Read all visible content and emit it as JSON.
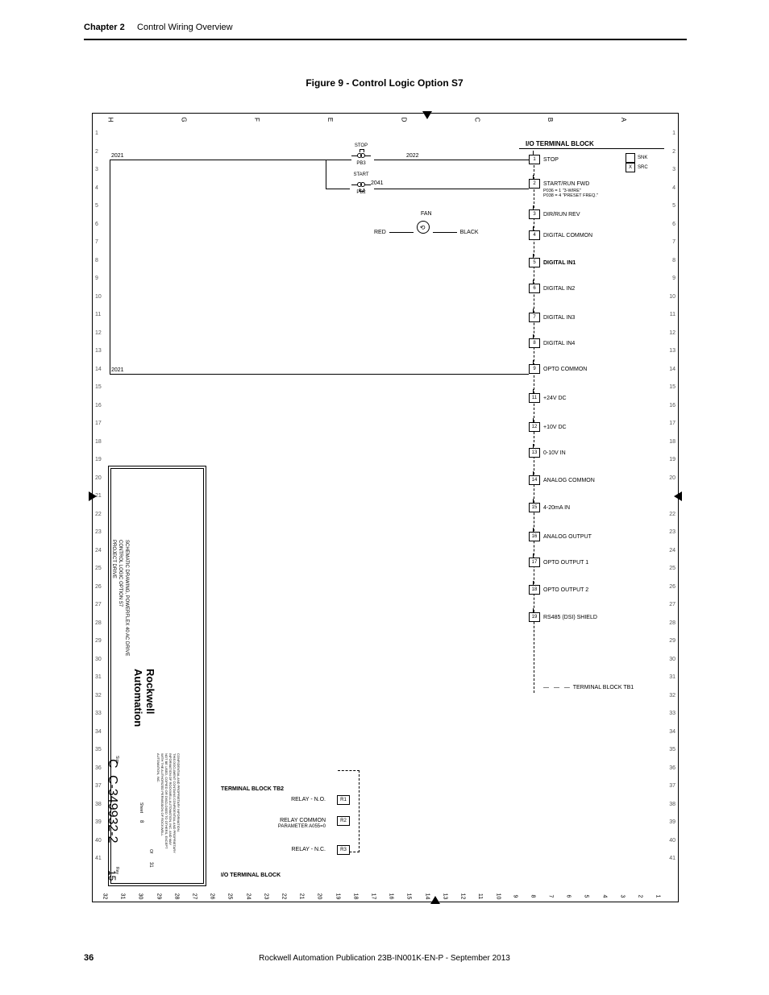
{
  "header": {
    "chapter": "Chapter 2",
    "section": "Control Wiring Overview"
  },
  "figure_title": "Figure 9 - Control Logic Option S7",
  "footer": {
    "page": "36",
    "publication": "Rockwell Automation Publication 23B-IN001K-EN-P - September 2013"
  },
  "grid": {
    "cols": [
      "H",
      "G",
      "F",
      "E",
      "D",
      "C",
      "B",
      "A"
    ],
    "left_rows": [
      "1",
      "2",
      "3",
      "4",
      "5",
      "6",
      "7",
      "8",
      "9",
      "10",
      "11",
      "12",
      "13",
      "14",
      "15",
      "16",
      "17",
      "18",
      "19",
      "20",
      "21",
      "22",
      "23",
      "24",
      "25",
      "26",
      "27",
      "28",
      "29",
      "30",
      "31",
      "32",
      "33",
      "34",
      "35",
      "36",
      "37",
      "38",
      "39",
      "40",
      "41"
    ],
    "right_rows": [
      "1",
      "2",
      "3",
      "4",
      "5",
      "6",
      "7",
      "8",
      "9",
      "10",
      "11",
      "12",
      "13",
      "14",
      "15",
      "16",
      "17",
      "18",
      "19",
      "20",
      "22",
      "23",
      "24",
      "25",
      "26",
      "27",
      "28",
      "29",
      "30",
      "31",
      "32",
      "33",
      "34",
      "35",
      "36",
      "37",
      "38",
      "39",
      "40",
      "41"
    ],
    "bottom_nums": [
      "32",
      "31",
      "30",
      "29",
      "28",
      "27",
      "26",
      "25",
      "24",
      "23",
      "22",
      "21",
      "20",
      "19",
      "18",
      "17",
      "16",
      "15",
      "14",
      "13",
      "12",
      "11",
      "10",
      "9",
      "8",
      "7",
      "6",
      "5",
      "4",
      "3",
      "2",
      "1"
    ]
  },
  "io_block": {
    "title": "I/O TERMINAL BLOCK",
    "snk": "SNK",
    "src": "SRC",
    "src_mark": "X",
    "tb1_label": "TERMINAL BLOCK TB1",
    "terminals": [
      {
        "n": "1",
        "label": "STOP"
      },
      {
        "n": "2",
        "label": "START/RUN FWD",
        "sub": "P036 = 1 \"3-WIRE\"\nP038 = 4 \"PRESET FREQ.\""
      },
      {
        "n": "3",
        "label": "DIR/RUN REV"
      },
      {
        "n": "4",
        "label": "DIGITAL COMMON"
      },
      {
        "n": "5",
        "label": "DIGITAL IN1",
        "bold": true
      },
      {
        "n": "6",
        "label": "DIGITAL IN2"
      },
      {
        "n": "7",
        "label": "DIGITAL IN3"
      },
      {
        "n": "8",
        "label": "DIGITAL IN4"
      },
      {
        "n": "9",
        "label": "OPTO COMMON"
      },
      {
        "n": "11",
        "label": "+24V DC"
      },
      {
        "n": "12",
        "label": "+10V DC"
      },
      {
        "n": "13",
        "label": "0-10V IN"
      },
      {
        "n": "14",
        "label": "ANALOG COMMON"
      },
      {
        "n": "15",
        "label": "4-20mA IN"
      },
      {
        "n": "16",
        "label": "ANALOG OUTPUT"
      },
      {
        "n": "17",
        "label": "OPTO OUTPUT 1"
      },
      {
        "n": "18",
        "label": "OPTO OUTPUT 2"
      },
      {
        "n": "19",
        "label": "RS485 (DSI) SHIELD"
      }
    ]
  },
  "pushbuttons": {
    "stop": {
      "label": "STOP",
      "ref": "PB3"
    },
    "start": {
      "label": "START",
      "ref": "PB2"
    }
  },
  "wire_refs": {
    "a": "2021",
    "b": "2022",
    "c": "2041",
    "d": "2021"
  },
  "fan": {
    "label": "FAN",
    "red": "RED",
    "black": "BLACK"
  },
  "relay_block": {
    "title": "TERMINAL BLOCK TB2",
    "io_title": "I/O TERMINAL BLOCK",
    "rows": [
      {
        "label": "RELAY - N.O.",
        "term": "R1"
      },
      {
        "label": "RELAY COMMON",
        "sub": "PARAMETER A055=0",
        "term": "R2"
      },
      {
        "label": "RELAY - N.C.",
        "term": "R3"
      }
    ]
  },
  "title_block": {
    "logo_top": "Rockwell",
    "logo_bot": "Automation",
    "line1": "SCHEMATIC DRAWING, POWERFLEX 40 AC DRIVE",
    "line2": "CONTROL LOGIC OPTION S7",
    "line3": "PROJECT DRIVE",
    "conf1": "CONFIDENTIAL AND PROPRIETARY INFORMATION.",
    "conf2": "THIS DOCUMENT CONTAINS CONFIDENTIAL AND PROPRIETARY",
    "conf3": "INFORMATION OF ROCKWELL AUTOMATION, INC. AND MAY",
    "conf4": "NOT BE USED, COPIED OR DISCLOSED TO OTHERS, EXCEPT",
    "conf5": "WITH THE AUTHORIZED PERMISSION OF ROCKWELL",
    "conf6": "AUTOMATION, INC.",
    "size": "Size",
    "size_v": "C",
    "dwg": "C-349932-2",
    "sheet_l": "Sheet",
    "sheet_v": "8",
    "of_l": "Of",
    "of_v": "31",
    "rev_l": "Rev",
    "rev_v": "15"
  }
}
